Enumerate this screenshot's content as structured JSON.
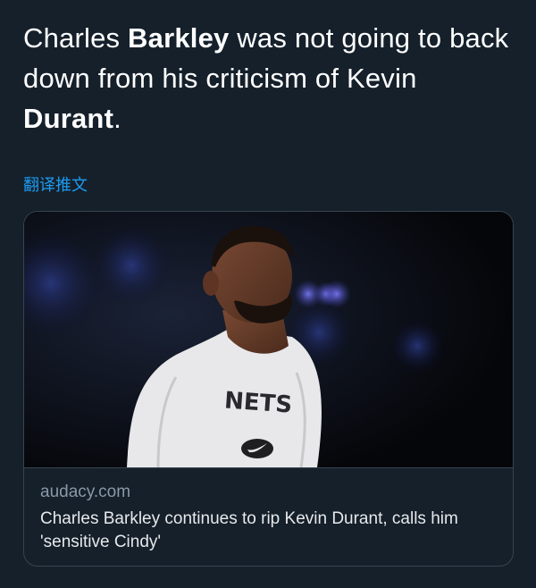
{
  "tweet": {
    "text_parts": [
      {
        "text": "Charles ",
        "bold": false
      },
      {
        "text": "Barkley",
        "bold": true
      },
      {
        "text": " was not going to back down from his criticism of Kevin ",
        "bold": false
      },
      {
        "text": "Durant",
        "bold": true
      },
      {
        "text": ".",
        "bold": false
      }
    ],
    "translate_label": "翻译推文"
  },
  "link_card": {
    "image_icon": "photo-of-kevin-durant",
    "shirt_text": "NETS",
    "domain": "audacy.com",
    "title": "Charles Barkley continues to rip Kevin Durant, calls him 'sensitive Cindy'"
  },
  "colors": {
    "background": "#15202b",
    "text": "#ffffff",
    "link": "#1d9bf0",
    "muted": "#8b98a5",
    "border": "#38444d"
  }
}
